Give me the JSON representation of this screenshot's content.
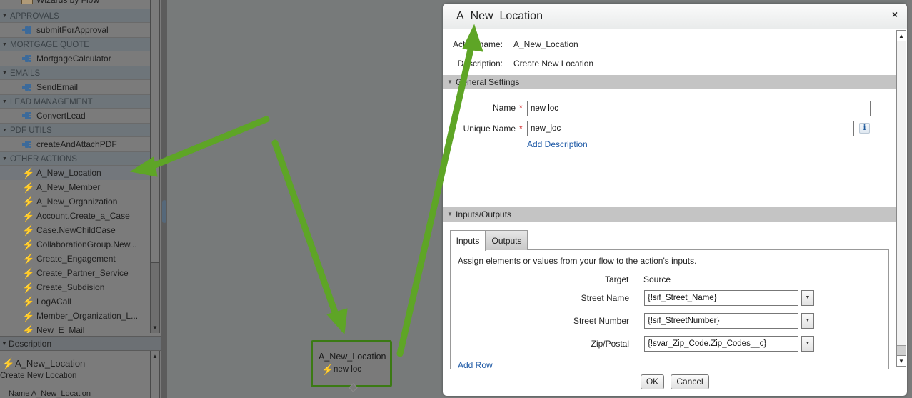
{
  "palette": {
    "partial_top_item": "Wizards by Flow",
    "groups": [
      {
        "category": "APPROVALS",
        "items": [
          "submitForApproval"
        ],
        "icon": "apex-plugin-icon"
      },
      {
        "category": "MORTGAGE QUOTE",
        "items": [
          "MortgageCalculator"
        ],
        "icon": "apex-plugin-icon"
      },
      {
        "category": "EMAILS",
        "items": [
          "SendEmail"
        ],
        "icon": "apex-plugin-icon"
      },
      {
        "category": "LEAD MANAGEMENT",
        "items": [
          "ConvertLead"
        ],
        "icon": "apex-plugin-icon"
      },
      {
        "category": "PDF UTILS",
        "items": [
          "createAndAttachPDF"
        ],
        "icon": "apex-plugin-icon"
      }
    ],
    "other_actions": {
      "category": "OTHER ACTIONS",
      "selected": "A_New_Location",
      "items": [
        "A_New_Location",
        "A_New_Member",
        "A_New_Organization",
        "Account.Create_a_Case",
        "Case.NewChildCase",
        "CollaborationGroup.New...",
        "Create_Engagement",
        "Create_Partner_Service",
        "Create_Subdision",
        "LogACall",
        "Member_Organization_L...",
        "New_E_Mail"
      ]
    }
  },
  "description_panel": {
    "header": "Description",
    "title": "A_New_Location",
    "subtitle": "Create New Location",
    "name_line": "Name  A_New_Location"
  },
  "canvas_node": {
    "title": "A_New_Location",
    "label": "new loc",
    "border_color": "#3b7a14"
  },
  "modal": {
    "title": "A_New_Location",
    "close_icon": "×",
    "meta": [
      {
        "label": "Action name:",
        "value": "A_New_Location"
      },
      {
        "label": "Description:",
        "value": "Create New Location"
      }
    ],
    "general_settings": {
      "header": "General Settings",
      "name_label": "Name",
      "name_value": "new loc",
      "unique_name_label": "Unique Name",
      "unique_name_value": "new_loc",
      "required_marker": "*",
      "info_icon": "i",
      "add_description": "Add Description"
    },
    "inputs_outputs": {
      "header": "Inputs/Outputs",
      "tabs": [
        {
          "label": "Inputs",
          "active": true
        },
        {
          "label": "Outputs",
          "active": false
        }
      ],
      "instructions": "Assign elements or values from your flow to the action's inputs.",
      "columns": {
        "target": "Target",
        "source": "Source"
      },
      "rows": [
        {
          "target": "Street Name",
          "source": "{!sif_Street_Name}"
        },
        {
          "target": "Street Number",
          "source": "{!sif_StreetNumber}"
        },
        {
          "target": "Zip/Postal",
          "source": "{!svar_Zip_Code.Zip_Codes__c}"
        }
      ],
      "add_row": "Add Row"
    },
    "footer": {
      "ok": "OK",
      "cancel": "Cancel"
    }
  },
  "annotation_color": "#5ea526"
}
